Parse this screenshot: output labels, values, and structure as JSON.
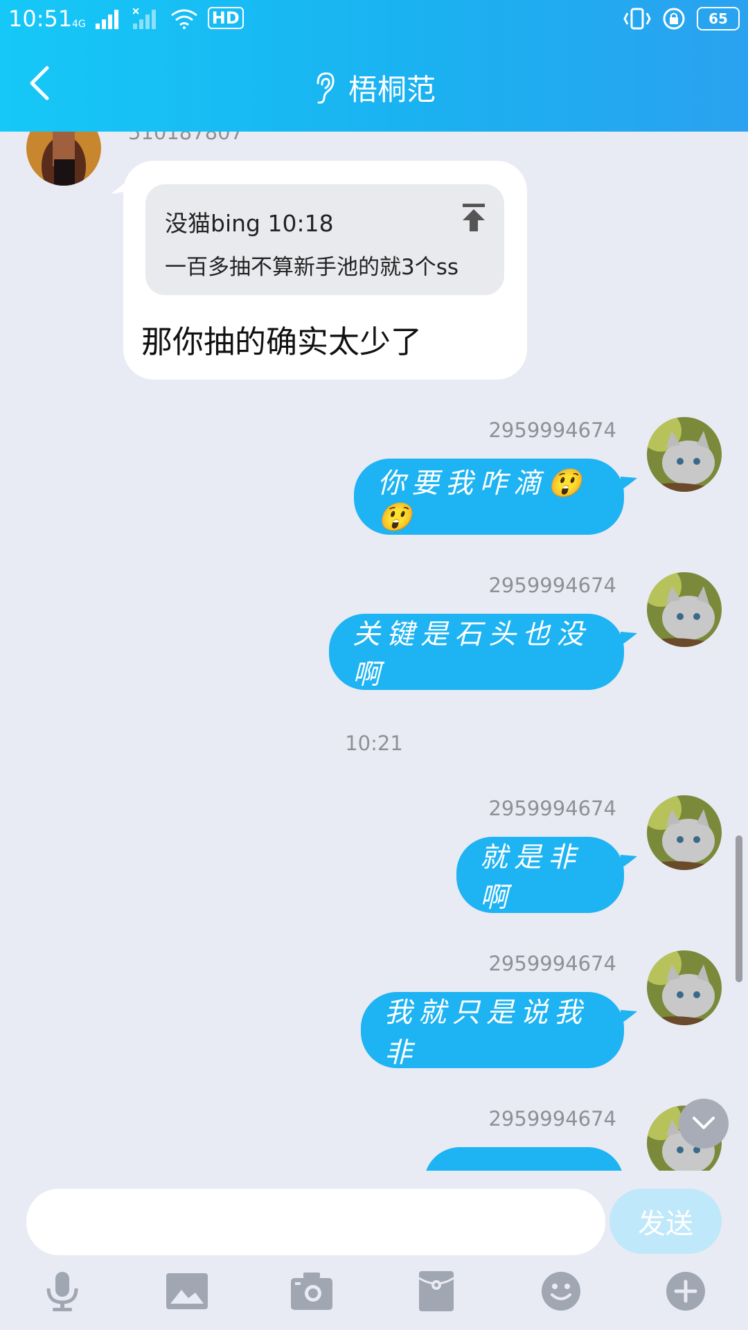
{
  "status_bar": {
    "time": "10:51",
    "network": "4G",
    "hd_label": "HD",
    "battery": "65"
  },
  "header": {
    "title": "梧桐范"
  },
  "messages": {
    "m1": {
      "sender": "510187807",
      "quote_author": "没猫bing",
      "quote_time": "10:18",
      "quote_text": "一百多抽不算新手池的就3个ss",
      "text": "那你抽的确实太少了"
    },
    "m2": {
      "sender": "2959994674",
      "text": "你要我咋滴😲😲"
    },
    "m3": {
      "sender": "2959994674",
      "text": "关键是石头也没啊"
    },
    "timestamp": "10:21",
    "m4": {
      "sender": "2959994674",
      "text": "就是非啊"
    },
    "m5": {
      "sender": "2959994674",
      "text": "我就只是说我非"
    },
    "m6": {
      "sender": "2959994674"
    }
  },
  "input": {
    "placeholder": "",
    "send_label": "发送"
  },
  "colors": {
    "header": "#1ab2f1",
    "bubble_self": "#1eb3f2",
    "bubble_other": "#ffffff",
    "background": "#e9ebf4"
  },
  "icons": [
    "back-icon",
    "ear-icon",
    "scroll-down-icon",
    "mic-icon",
    "image-icon",
    "camera-icon",
    "red-packet-icon",
    "emoji-icon",
    "plus-icon"
  ]
}
